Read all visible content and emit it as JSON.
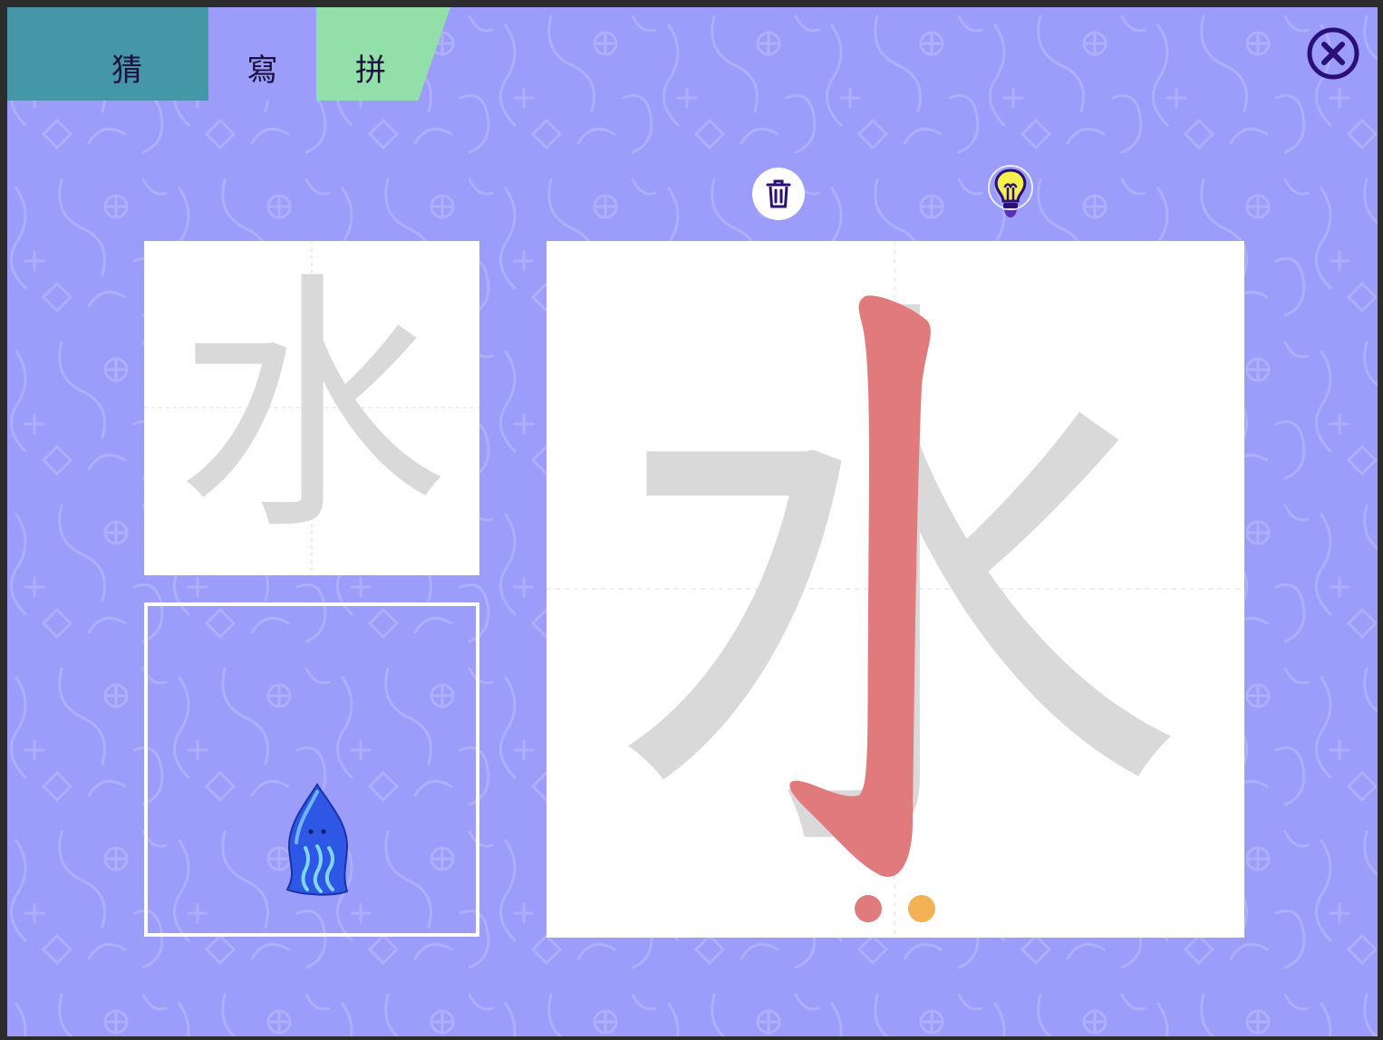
{
  "tabs": [
    {
      "label": "猜"
    },
    {
      "label": "寫"
    },
    {
      "label": "拼"
    }
  ],
  "character": "水",
  "colors": {
    "background": "#9c9cfb",
    "tab_guess": "#4596a6",
    "tab_write": "#9c9cfb",
    "tab_spell": "#93dfaa",
    "glyph_outline": "#d9d9d9",
    "stroke_done": "#e17a7c",
    "dot_1": "#e17a7c",
    "dot_2": "#f3b155",
    "icon_dark": "#2a0f78"
  },
  "stroke_progress": {
    "done": 1,
    "total": 4
  },
  "icons": [
    "close-icon",
    "trash-icon",
    "lightbulb-icon",
    "water-creature-icon"
  ]
}
